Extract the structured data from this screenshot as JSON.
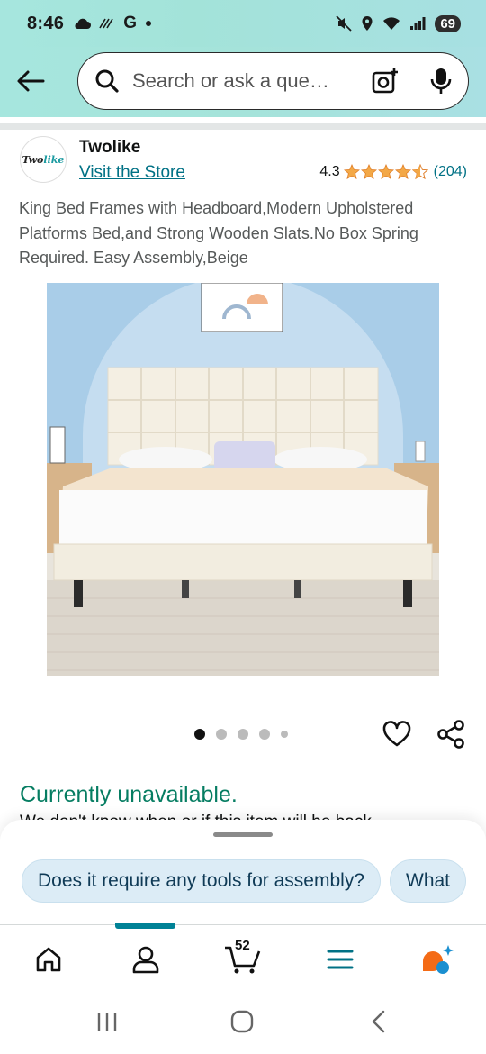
{
  "status_bar": {
    "time": "8:46",
    "carrier": "G",
    "battery": "69",
    "icons": [
      "cloud-icon",
      "wifi-calling-icon",
      "dot-icon",
      "mute-icon",
      "location-icon",
      "wifi-icon",
      "signal-icon",
      "battery-icon"
    ]
  },
  "search": {
    "placeholder": "Search or ask a que…",
    "icons": [
      "back-arrow-icon",
      "search-icon",
      "camera-lens-icon",
      "microphone-icon"
    ]
  },
  "store": {
    "logo_text_1": "Two",
    "logo_text_2": "like",
    "name": "Twolike",
    "link": "Visit the Store",
    "rating": "4.3",
    "stars": 4.3,
    "rating_count": "(204)",
    "star_color": "#f3a847"
  },
  "product": {
    "title": "King Bed Frames with Headboard,Modern Upholstered Platforms Bed,and Strong Wooden Slats.No Box Spring Required. Easy Assembly,Beige",
    "image_count": 5,
    "active_image": 0
  },
  "availability": {
    "status": "Currently unavailable.",
    "detail": "We don't know when or if this item will be back",
    "status_color": "#067d62"
  },
  "suggestions": {
    "chips": [
      "Does it require any tools for assembly?",
      "What"
    ]
  },
  "bottom_nav": {
    "cart_count": "52",
    "items": [
      "home-icon",
      "account-icon",
      "cart-icon",
      "menu-icon",
      "rufus-icon"
    ],
    "accent_color": "#008296"
  },
  "android_nav": {
    "items": [
      "recents-icon",
      "home-circle-icon",
      "back-icon"
    ]
  }
}
